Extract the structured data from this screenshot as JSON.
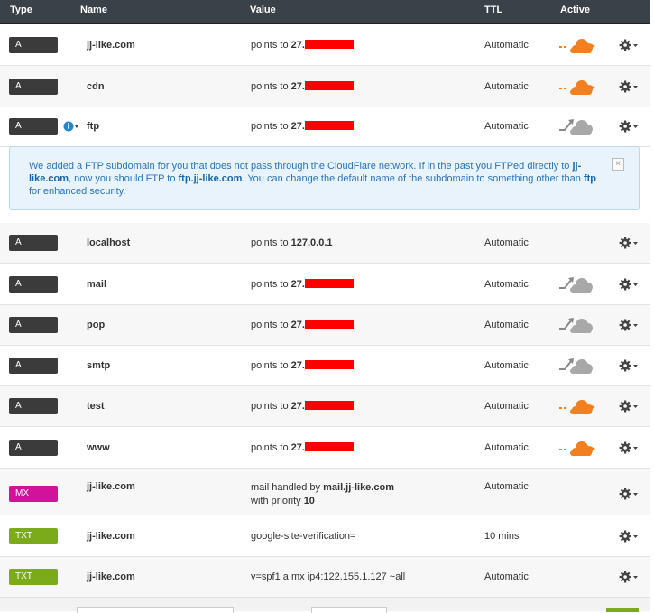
{
  "header": {
    "type": "Type",
    "name": "Name",
    "value": "Value",
    "ttl": "TTL",
    "active": "Active"
  },
  "records": [
    {
      "type": "A",
      "name": "jj-like.com",
      "value_prefix": "points to ",
      "value_bold": "27.",
      "ttl": "Automatic",
      "active": "orange"
    },
    {
      "type": "A",
      "name": "cdn",
      "value_prefix": "points to ",
      "value_bold": "27.",
      "ttl": "Automatic",
      "active": "orange"
    },
    {
      "type": "A",
      "name": "ftp",
      "value_prefix": "points to ",
      "value_bold": "27.",
      "ttl": "Automatic",
      "active": "gray"
    },
    {
      "type": "A",
      "name": "localhost",
      "value_prefix": "points to ",
      "value_bold": "127.0.0.1",
      "ttl": "Automatic",
      "active": "none"
    },
    {
      "type": "A",
      "name": "mail",
      "value_prefix": "points to ",
      "value_bold": "27.",
      "ttl": "Automatic",
      "active": "gray"
    },
    {
      "type": "A",
      "name": "pop",
      "value_prefix": "points to ",
      "value_bold": "27.",
      "ttl": "Automatic",
      "active": "gray"
    },
    {
      "type": "A",
      "name": "smtp",
      "value_prefix": "points to ",
      "value_bold": "27.",
      "ttl": "Automatic",
      "active": "gray"
    },
    {
      "type": "A",
      "name": "test",
      "value_prefix": "points to ",
      "value_bold": "27.",
      "ttl": "Automatic",
      "active": "orange"
    },
    {
      "type": "A",
      "name": "www",
      "value_prefix": "points to ",
      "value_bold": "27.",
      "ttl": "Automatic",
      "active": "orange"
    },
    {
      "type": "MX",
      "name": "jj-like.com",
      "value_prefix": "mail handled by ",
      "value_bold": "mail.jj-like.com",
      "value_line2_prefix": "with priority ",
      "value_line2_bold": "10",
      "ttl": "Automatic",
      "active": "none"
    },
    {
      "type": "TXT",
      "name": "jj-like.com",
      "value_prefix": "google-site-verification=",
      "value_bold": "",
      "ttl": "10 mins",
      "active": "none"
    },
    {
      "type": "TXT",
      "name": "jj-like.com",
      "value_prefix": "v=spf1 a mx ip4:122.155.1.127 ~all",
      "value_bold": "",
      "ttl": "Automatic",
      "active": "none"
    }
  ],
  "notice": {
    "t1": "We added a FTP subdomain for you that does not pass through the CloudFlare network. If in the past you FTPed directly to ",
    "b1": "jj-like.com",
    "t2": ", now you should FTP to ",
    "b2": "ftp.jj-like.com",
    "t3": ". You can change the default name of the subdomain to something other than ",
    "b3": "ftp",
    "t4": " for enhanced security.",
    "close": "×"
  },
  "colors": {
    "orange_cloud": "#f38020",
    "gray_cloud": "#a8a8a8",
    "mx": "#d2139a",
    "txt": "#7bab1b",
    "a": "#3b3b3b"
  },
  "icons": {
    "gear": "gear-icon",
    "info": "info-icon",
    "cloud": "cloud-icon"
  }
}
